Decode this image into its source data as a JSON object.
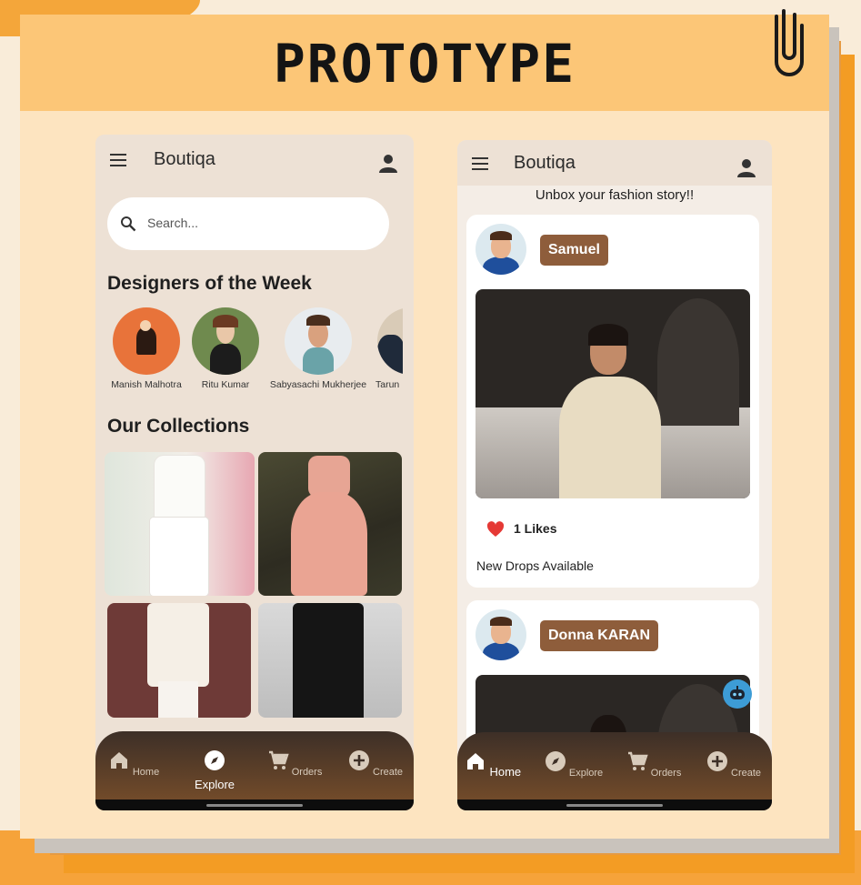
{
  "banner": {
    "title": "PROTOTYPE"
  },
  "colors": {
    "accent_brown": "#8e5d3b",
    "banner": "#fcc677",
    "card": "#fde4c0"
  },
  "left_phone": {
    "app_title": "Boutiqa",
    "search": {
      "placeholder": "Search..."
    },
    "designers_title": "Designers of the Week",
    "designers": [
      {
        "name": "Manish Malhotra"
      },
      {
        "name": "Ritu Kumar"
      },
      {
        "name": "Sabyasachi Mukherjee"
      },
      {
        "name": "Tarun"
      }
    ],
    "collections_title": "Our Collections",
    "nav": [
      {
        "label": "Home",
        "icon": "home-icon"
      },
      {
        "label": "Explore",
        "icon": "compass-icon"
      },
      {
        "label": "Orders",
        "icon": "cart-icon"
      },
      {
        "label": "Create",
        "icon": "add-circle-icon"
      }
    ],
    "active_nav": "Explore"
  },
  "right_phone": {
    "app_title": "Boutiqa",
    "tagline": "Unbox your fashion story!!",
    "posts": [
      {
        "user": "Samuel",
        "likes": "1 Likes",
        "caption": "New Drops Available"
      },
      {
        "user": "Donna KARAN"
      }
    ],
    "nav": [
      {
        "label": "Home",
        "icon": "home-icon"
      },
      {
        "label": "Explore",
        "icon": "compass-icon"
      },
      {
        "label": "Orders",
        "icon": "cart-icon"
      },
      {
        "label": "Create",
        "icon": "add-circle-icon"
      }
    ],
    "active_nav": "Home"
  }
}
